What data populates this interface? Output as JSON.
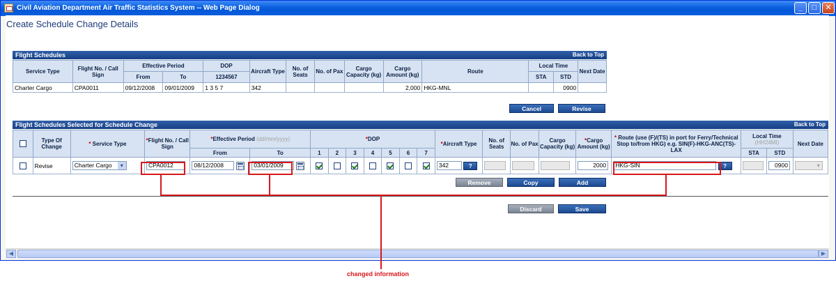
{
  "window": {
    "title": "Civil Aviation Department Air Traffic Statistics System -- Web Page Dialog",
    "minimize_glyph": "_",
    "maximize_glyph": "□",
    "close_glyph": "✕"
  },
  "page": {
    "title": "Create Schedule Change Details"
  },
  "schedules": {
    "section_title": "Flight Schedules",
    "back_to_top": "Back to Top",
    "headers": {
      "service_type": "Service Type",
      "flight_no": "Flight No. / Call Sign",
      "effective_period": "Effective Period",
      "from": "From",
      "to": "To",
      "dop": "DOP",
      "dop_days": "1234567",
      "aircraft_type": "Aircraft Type",
      "no_of_seats": "No. of Seats",
      "no_of_pax": "No. of Pax",
      "cargo_capacity": "Cargo Capacity (kg)",
      "cargo_amount": "Cargo Amount (kg)",
      "route": "Route",
      "local_time": "Local Time",
      "sta": "STA",
      "std": "STD",
      "next_date": "Next Date"
    },
    "row": {
      "service_type": "Charter Cargo",
      "flight_no": "CPA0011",
      "from": "09/12/2008",
      "to": "09/01/2009",
      "dop": "1  3  5  7",
      "aircraft_type": "342",
      "no_of_seats": "",
      "no_of_pax": "",
      "cargo_capacity": "",
      "cargo_amount": "2,000",
      "route": "HKG-MNL",
      "sta": "",
      "std": "0900",
      "next_date": ""
    },
    "cancel_label": "Cancel",
    "revise_label": "Revise"
  },
  "selected": {
    "section_title": "Flight Schedules Selected for Schedule Change",
    "back_to_top": "Back to Top",
    "headers": {
      "type_of_change": "Type Of Change",
      "service_type": "Service Type",
      "flight_no": "Flight No. / Call Sign",
      "effective_period": "Effective Period",
      "date_hint": "(dd/mm/yyyy)",
      "from": "From",
      "to": "To",
      "dop": "DOP",
      "days": [
        "1",
        "2",
        "3",
        "4",
        "5",
        "6",
        "7"
      ],
      "aircraft_type": "Aircraft Type",
      "no_of_seats": "No. of Seats",
      "no_of_pax": "No. of Pax",
      "cargo_capacity": "Cargo Capacity (kg)",
      "cargo_amount": "Cargo Amount (kg)",
      "route": "Route (use (F)/(TS) in port for Ferry/Technical Stop to/from HKG) e.g. SIN(F)-HKG-ANC(TS)-LAX",
      "local_time": "Local Time",
      "local_time_hint": "(HH24MI)",
      "sta": "STA",
      "std": "STD",
      "next_date": "Next Date"
    },
    "row": {
      "type_of_change": "Revise",
      "service_type": "Charter Cargo",
      "flight_no": "CPA0012",
      "from": "08/12/2008",
      "to": "03/01/2009",
      "aircraft_type": "342",
      "lookup_label": "?",
      "cargo_amount": "2000",
      "route": "HKG-SIN",
      "std": "0900"
    },
    "remove_label": "Remove",
    "copy_label": "Copy",
    "add_label": "Add"
  },
  "footer": {
    "discard_label": "Discard",
    "save_label": "Save"
  },
  "annotation": {
    "callout": "changed information"
  },
  "colors": {
    "title_bar": "#0a5fe0",
    "section_bar": "#1f4b93",
    "header_bg": "#d7e3f2",
    "highlight": "#d8181c"
  }
}
